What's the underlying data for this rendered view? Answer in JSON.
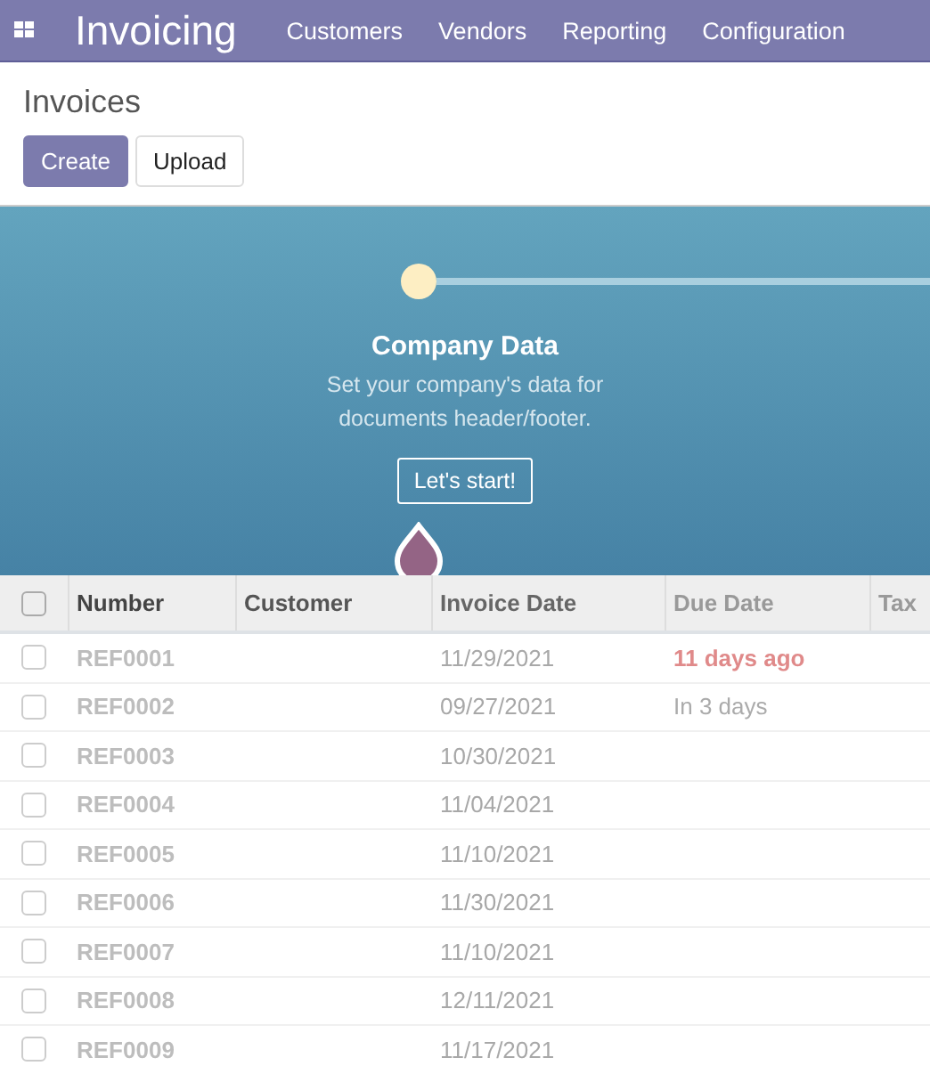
{
  "navbar": {
    "app_title": "Invoicing",
    "menu": [
      "Customers",
      "Vendors",
      "Reporting",
      "Configuration"
    ]
  },
  "control_panel": {
    "breadcrumb": "Invoices",
    "buttons": [
      {
        "label": "Create",
        "kind": "primary"
      },
      {
        "label": "Upload",
        "kind": "secondary"
      }
    ]
  },
  "onboarding": {
    "step_title": "Company Data",
    "step_description": "Set your company's data for documents header/footer.",
    "step_button": "Let's start!"
  },
  "table": {
    "select_all_checked": false,
    "columns": [
      "Number",
      "Customer",
      "Invoice Date",
      "Due Date",
      "Tax"
    ],
    "rows": [
      {
        "number": "REF0001",
        "invoice_date": "11/29/2021",
        "due_date": "11 days ago",
        "overdue": true,
        "checked": false
      },
      {
        "number": "REF0002",
        "invoice_date": "09/27/2021",
        "due_date": "In 3 days",
        "overdue": false,
        "checked": false
      },
      {
        "number": "REF0003",
        "invoice_date": "10/30/2021",
        "checked": false
      },
      {
        "number": "REF0004",
        "invoice_date": "11/04/2021",
        "checked": false
      },
      {
        "number": "REF0005",
        "invoice_date": "11/10/2021",
        "checked": false
      },
      {
        "number": "REF0006",
        "invoice_date": "11/30/2021",
        "checked": false
      },
      {
        "number": "REF0007",
        "invoice_date": "11/10/2021",
        "checked": false
      },
      {
        "number": "REF0008",
        "invoice_date": "12/11/2021",
        "checked": false
      },
      {
        "number": "REF0009",
        "invoice_date": "11/17/2021",
        "checked": false
      }
    ]
  }
}
